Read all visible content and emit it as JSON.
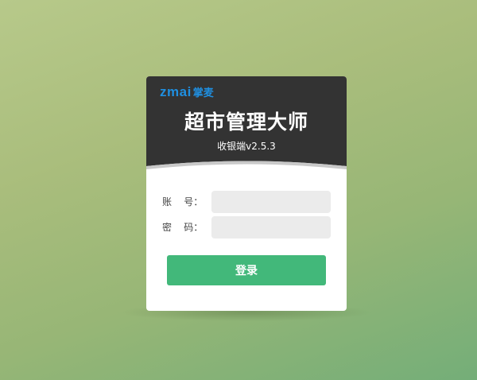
{
  "logo": {
    "latin": "zmai",
    "chinese": "掌麦"
  },
  "header": {
    "title": "超市管理大师",
    "version": "收银端v2.5.3"
  },
  "form": {
    "account": {
      "label": "账    号：",
      "value": "",
      "placeholder": ""
    },
    "password": {
      "label": "密    码：",
      "value": "",
      "placeholder": ""
    },
    "login_button": "登录"
  },
  "colors": {
    "header_bg": "#333333",
    "brand_blue": "#1f8fe0",
    "button_green": "#42b87a",
    "input_bg": "#ebebeb"
  }
}
